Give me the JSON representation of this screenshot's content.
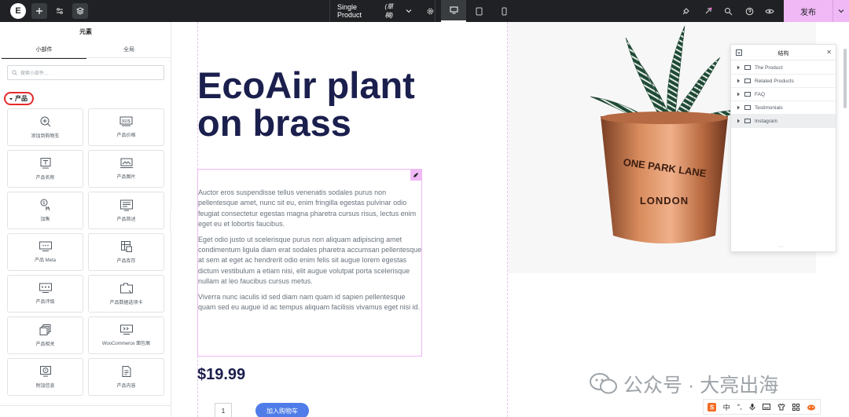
{
  "topbar": {
    "logo": "E",
    "document_title": "Single Product",
    "document_status": "(草稿)",
    "publish_label": "发布"
  },
  "panel": {
    "title": "元素",
    "tabs": [
      "小部件",
      "全局"
    ],
    "search_placeholder": "搜索小部件...",
    "category": "产品",
    "widgets": [
      {
        "label": "添加到购物车",
        "icon": "add-to-cart-icon"
      },
      {
        "label": "产品价格",
        "icon": "product-price-icon"
      },
      {
        "label": "产品名称",
        "icon": "product-title-icon"
      },
      {
        "label": "产品图片",
        "icon": "product-images-icon"
      },
      {
        "label": "加售",
        "icon": "upsell-icon"
      },
      {
        "label": "产品简述",
        "icon": "short-description-icon"
      },
      {
        "label": "产品 Meta",
        "icon": "product-meta-icon"
      },
      {
        "label": "产品库存",
        "icon": "product-stock-icon"
      },
      {
        "label": "产品评级",
        "icon": "product-rating-icon"
      },
      {
        "label": "产品数据选项卡",
        "icon": "product-data-tabs-icon"
      },
      {
        "label": "产品相关",
        "icon": "product-related-icon"
      },
      {
        "label": "WooCommerce 面包屑",
        "icon": "breadcrumbs-icon"
      },
      {
        "label": "附加信息",
        "icon": "additional-info-icon"
      },
      {
        "label": "产品内容",
        "icon": "product-content-icon"
      }
    ]
  },
  "page": {
    "heading_line1": "EcoAir plant",
    "heading_line2": "on brass",
    "paragraphs": [
      "Auctor eros suspendisse tellus venenatis sodales purus non pellentesque amet, nunc sit eu, enim fringilla egestas pulvinar odio feugiat consectetur egestas magna pharetra cursus risus, lectus enim eget eu et lobortis faucibus.",
      "Eget odio justo ut scelerisque purus non aliquam adipiscing amet condimentum ligula diam erat sodales pharetra accumsan pellentesque at sem at eget ac hendrerit odio enim felis sit augue lorem egestas dictum vestibulum a etiam nisi, elit augue volutpat porta scelerisque nullam at leo faucibus cursus metus.",
      "Viverra nunc iaculis id sed diam nam quam id sapien pellentesque quam sed eu augue id ac tempus aliquam facilisis vivamus eget nisi id."
    ],
    "price": "$19.99",
    "quantity": "1",
    "add_to_cart": "加入购物车",
    "pot_text_top": "ONE PARK LANE",
    "pot_text_bottom": "LONDON"
  },
  "structure": {
    "title": "结构",
    "items": [
      "The Product",
      "Related Products",
      "FAQ",
      "Testimonials",
      "Instagram"
    ],
    "selected_item": "Instagram"
  },
  "overlay": {
    "watermark": "公众号 · 大亮出海",
    "ime_label": "中"
  },
  "colors": {
    "accent_pink": "#f0b8f5",
    "heading": "#1b1f4d",
    "button_blue": "#4f7ce8",
    "copper": "#c97a4f"
  }
}
